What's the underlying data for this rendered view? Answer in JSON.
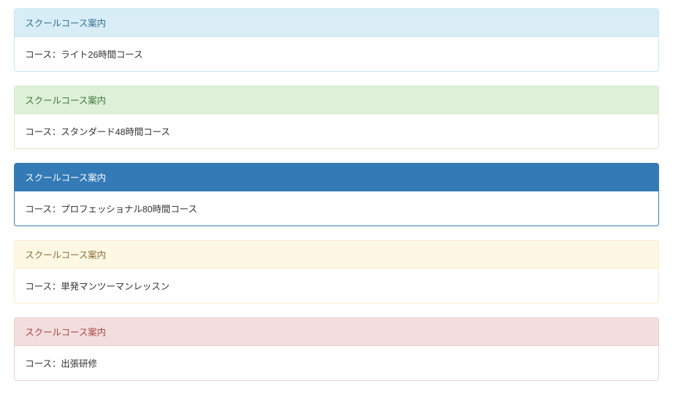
{
  "panels": [
    {
      "style": "info",
      "heading": "スクールコース案内",
      "body": "コース：ライト26時間コース"
    },
    {
      "style": "success",
      "heading": "スクールコース案内",
      "body": "コース：スタンダード48時間コース"
    },
    {
      "style": "primary",
      "heading": "スクールコース案内",
      "body": "コース：プロフェッショナル80時間コース"
    },
    {
      "style": "warning",
      "heading": "スクールコース案内",
      "body": "コース：単発マンツーマンレッスン"
    },
    {
      "style": "danger",
      "heading": "スクールコース案内",
      "body": "コース：出張研修"
    }
  ]
}
